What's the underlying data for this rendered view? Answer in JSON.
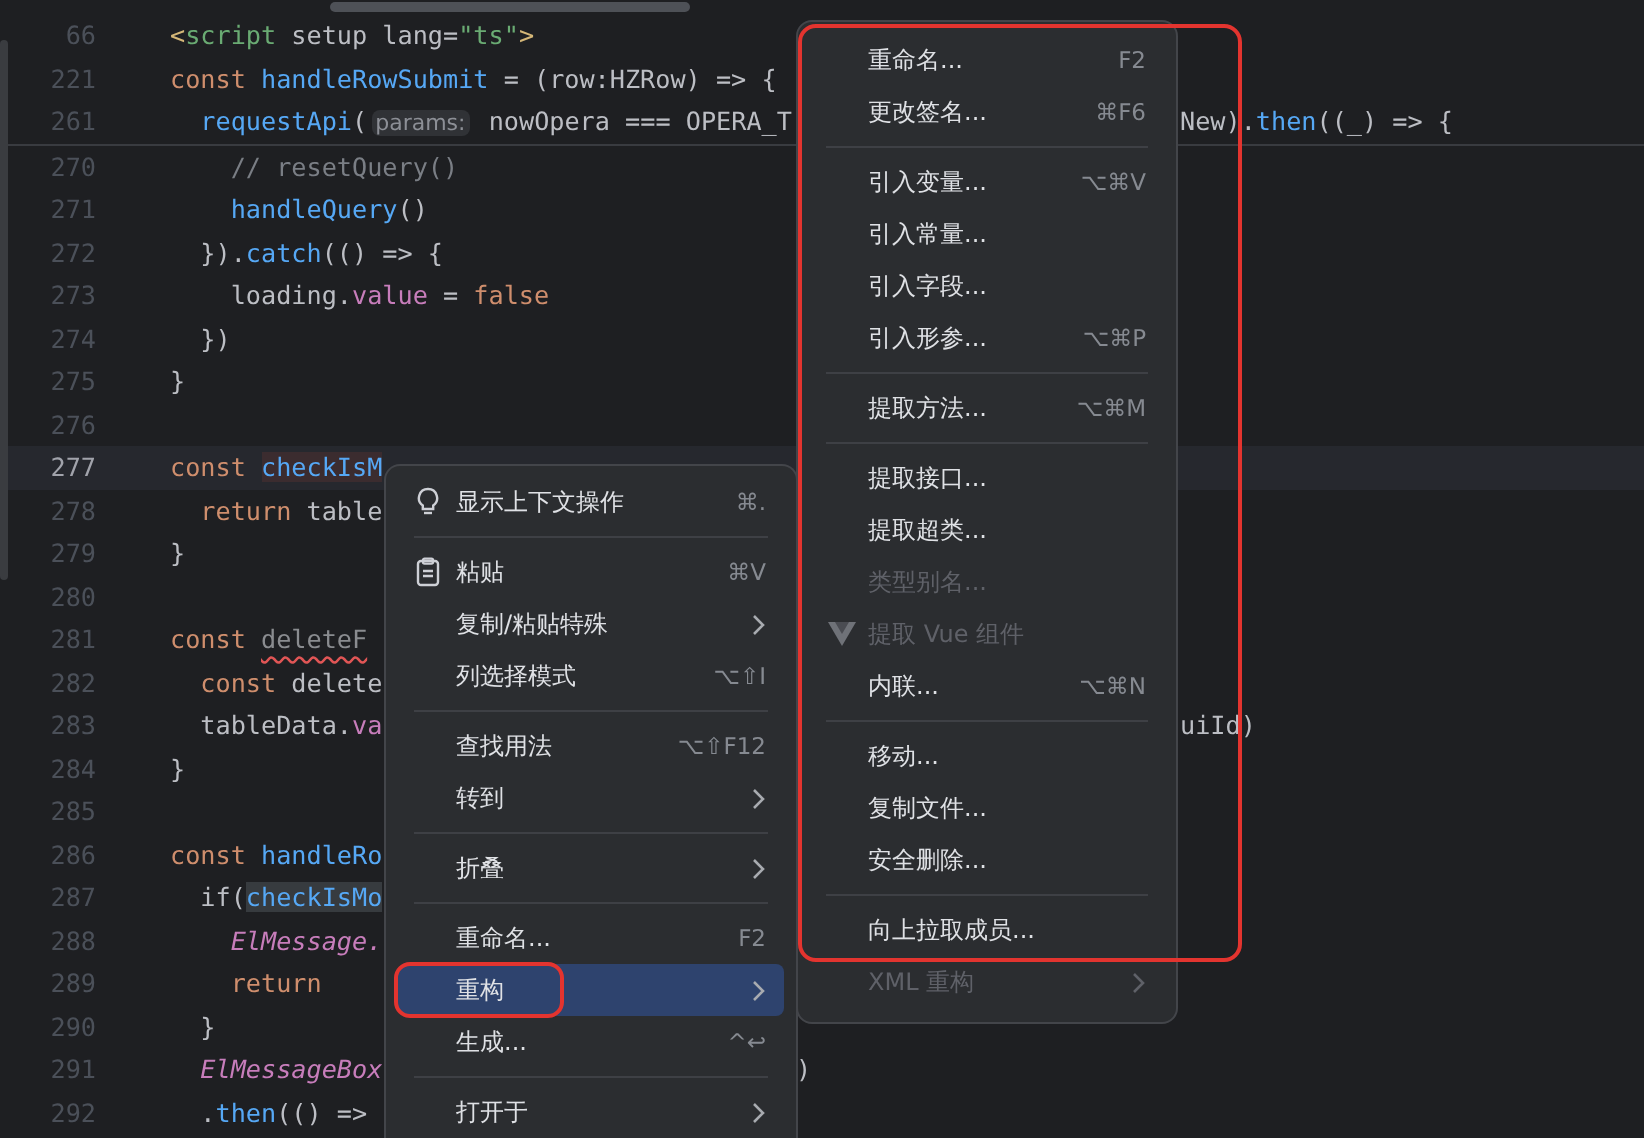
{
  "editor": {
    "sticky_lines": [
      {
        "number": "66",
        "current": false,
        "tokens": [
          {
            "kind": "tag",
            "text": "<"
          },
          {
            "kind": "tagname",
            "text": "script"
          },
          {
            "kind": "plain",
            "text": " setup lang="
          },
          {
            "kind": "string",
            "text": "\"ts\""
          },
          {
            "kind": "tag",
            "text": ">"
          }
        ]
      },
      {
        "number": "221",
        "current": false,
        "tokens": [
          {
            "kind": "keyword",
            "text": "const "
          },
          {
            "kind": "fn",
            "text": "handleRowSubmit"
          },
          {
            "kind": "plain",
            "text": " = (row:HZRow) => {"
          }
        ]
      },
      {
        "number": "261",
        "current": false,
        "tokens": [
          {
            "kind": "fn",
            "text": "  requestApi"
          },
          {
            "kind": "plain",
            "text": "("
          },
          {
            "kind": "inlay",
            "text": "params:"
          },
          {
            "kind": "plain",
            "text": " nowOpera === OPERA_T"
          }
        ],
        "far_tokens": [
          {
            "kind": "plain",
            "text": "New)."
          },
          {
            "kind": "fn",
            "text": "then"
          },
          {
            "kind": "plain",
            "text": "((_) => {"
          }
        ]
      }
    ],
    "lines": [
      {
        "number": "270",
        "current": false,
        "tokens": [
          {
            "kind": "comment",
            "text": "    // resetQuery()"
          }
        ]
      },
      {
        "number": "271",
        "current": false,
        "tokens": [
          {
            "kind": "fn",
            "text": "    handleQuery"
          },
          {
            "kind": "plain",
            "text": "()"
          }
        ]
      },
      {
        "number": "272",
        "current": false,
        "tokens": [
          {
            "kind": "plain",
            "text": "  })."
          },
          {
            "kind": "fn",
            "text": "catch"
          },
          {
            "kind": "plain",
            "text": "(() => {"
          }
        ]
      },
      {
        "number": "273",
        "current": false,
        "tokens": [
          {
            "kind": "plain",
            "text": "    loading."
          },
          {
            "kind": "prop",
            "text": "value"
          },
          {
            "kind": "plain",
            "text": " = "
          },
          {
            "kind": "keyword",
            "text": "false"
          }
        ]
      },
      {
        "number": "274",
        "current": false,
        "tokens": [
          {
            "kind": "plain",
            "text": "  })"
          }
        ]
      },
      {
        "number": "275",
        "current": false,
        "tokens": [
          {
            "kind": "plain",
            "text": "}"
          }
        ]
      },
      {
        "number": "276",
        "current": false
      },
      {
        "number": "277",
        "current": true,
        "tokens": [
          {
            "kind": "keyword",
            "text": "const "
          },
          {
            "kind": "fn_usage",
            "text": "checkIsM"
          }
        ]
      },
      {
        "number": "278",
        "current": false,
        "tokens": [
          {
            "kind": "keyword",
            "text": "  return "
          },
          {
            "kind": "plain",
            "text": "table"
          }
        ]
      },
      {
        "number": "279",
        "current": false,
        "tokens": [
          {
            "kind": "plain",
            "text": "}"
          }
        ]
      },
      {
        "number": "280",
        "current": false
      },
      {
        "number": "281",
        "current": false,
        "tokens": [
          {
            "kind": "keyword",
            "text": "const "
          },
          {
            "kind": "unused_error",
            "text": "deleteF"
          }
        ]
      },
      {
        "number": "282",
        "current": false,
        "tokens": [
          {
            "kind": "keyword",
            "text": "  const "
          },
          {
            "kind": "plain",
            "text": "delete"
          }
        ]
      },
      {
        "number": "283",
        "current": false,
        "tokens": [
          {
            "kind": "plain",
            "text": "  tableData."
          },
          {
            "kind": "prop",
            "text": "va"
          }
        ],
        "far_tokens": [
          {
            "kind": "plain",
            "text": "uiId)"
          }
        ]
      },
      {
        "number": "284",
        "current": false,
        "tokens": [
          {
            "kind": "plain",
            "text": "}"
          }
        ]
      },
      {
        "number": "285",
        "current": false
      },
      {
        "number": "286",
        "current": false,
        "tokens": [
          {
            "kind": "keyword",
            "text": "const "
          },
          {
            "kind": "fn",
            "text": "handleRo"
          }
        ]
      },
      {
        "number": "287",
        "current": false,
        "tokens": [
          {
            "kind": "plain",
            "text": "  if("
          },
          {
            "kind": "fn_highlight",
            "text": "checkIsMo"
          }
        ]
      },
      {
        "number": "288",
        "current": false,
        "tokens": [
          {
            "kind": "italic_prop",
            "text": "    ElMessage."
          }
        ]
      },
      {
        "number": "289",
        "current": false,
        "tokens": [
          {
            "kind": "keyword",
            "text": "    return"
          }
        ]
      },
      {
        "number": "290",
        "current": false,
        "tokens": [
          {
            "kind": "plain",
            "text": "  }"
          }
        ]
      },
      {
        "number": "291",
        "current": false,
        "tokens": [
          {
            "kind": "italic_prop",
            "text": "  ElMessageBox"
          }
        ],
        "mid_tokens": [
          {
            "kind": "plain",
            "text": ")"
          }
        ]
      },
      {
        "number": "292",
        "current": false,
        "tokens": [
          {
            "kind": "plain",
            "text": "  ."
          },
          {
            "kind": "fn",
            "text": "then"
          },
          {
            "kind": "plain",
            "text": "(() =>"
          }
        ]
      }
    ]
  },
  "context_menu": {
    "items": [
      {
        "kind": "item",
        "label": "显示上下文操作",
        "shortcut": "⌘.",
        "submenu": false,
        "disabled": false,
        "selected": false,
        "circled": false
      },
      {
        "kind": "separator"
      },
      {
        "kind": "item",
        "label": "粘贴",
        "shortcut": "⌘V",
        "submenu": false,
        "disabled": false,
        "selected": false,
        "circled": false
      },
      {
        "kind": "item",
        "label": "复制/粘贴特殊",
        "submenu": true,
        "disabled": false,
        "selected": false,
        "circled": false
      },
      {
        "kind": "item",
        "label": "列选择模式",
        "shortcut": "⌥⇧I",
        "submenu": false,
        "disabled": false,
        "selected": false,
        "circled": false
      },
      {
        "kind": "separator"
      },
      {
        "kind": "item",
        "label": "查找用法",
        "shortcut": "⌥⇧F12",
        "submenu": false,
        "disabled": false,
        "selected": false,
        "circled": false
      },
      {
        "kind": "item",
        "label": "转到",
        "submenu": true,
        "disabled": false,
        "selected": false,
        "circled": false
      },
      {
        "kind": "separator"
      },
      {
        "kind": "item",
        "label": "折叠",
        "submenu": true,
        "disabled": false,
        "selected": false,
        "circled": false
      },
      {
        "kind": "separator"
      },
      {
        "kind": "item",
        "label": "重命名...",
        "shortcut": "F2",
        "submenu": false,
        "disabled": false,
        "selected": false,
        "circled": false
      },
      {
        "kind": "item",
        "label": "重构",
        "submenu": true,
        "disabled": false,
        "selected": true,
        "circled": true
      },
      {
        "kind": "item",
        "label": "生成...",
        "shortcut": "^↩",
        "submenu": false,
        "disabled": false,
        "selected": false,
        "circled": false
      },
      {
        "kind": "separator"
      },
      {
        "kind": "item",
        "label": "打开于",
        "submenu": true,
        "disabled": false,
        "selected": false,
        "circled": false
      }
    ]
  },
  "refactor_submenu": {
    "circled": true,
    "items": [
      {
        "kind": "item",
        "label": "重命名...",
        "shortcut": "F2",
        "submenu": false,
        "disabled": false,
        "selected": false
      },
      {
        "kind": "item",
        "label": "更改签名...",
        "shortcut": "⌘F6",
        "submenu": false,
        "disabled": false,
        "selected": false
      },
      {
        "kind": "separator"
      },
      {
        "kind": "item",
        "label": "引入变量...",
        "shortcut": "⌥⌘V",
        "submenu": false,
        "disabled": false,
        "selected": false
      },
      {
        "kind": "item",
        "label": "引入常量...",
        "submenu": false,
        "disabled": false,
        "selected": false
      },
      {
        "kind": "item",
        "label": "引入字段...",
        "submenu": false,
        "disabled": false,
        "selected": false
      },
      {
        "kind": "item",
        "label": "引入形参...",
        "shortcut": "⌥⌘P",
        "submenu": false,
        "disabled": false,
        "selected": false
      },
      {
        "kind": "separator"
      },
      {
        "kind": "item",
        "label": "提取方法...",
        "shortcut": "⌥⌘M",
        "submenu": false,
        "disabled": false,
        "selected": false
      },
      {
        "kind": "separator"
      },
      {
        "kind": "item",
        "label": "提取接口...",
        "submenu": false,
        "disabled": false,
        "selected": false
      },
      {
        "kind": "item",
        "label": "提取超类...",
        "submenu": false,
        "disabled": false,
        "selected": false
      },
      {
        "kind": "item",
        "label": "类型别名...",
        "submenu": false,
        "disabled": true,
        "selected": false
      },
      {
        "kind": "item",
        "label": "提取 Vue 组件",
        "submenu": false,
        "disabled": true,
        "selected": false
      },
      {
        "kind": "item",
        "label": "内联...",
        "shortcut": "⌥⌘N",
        "submenu": false,
        "disabled": false,
        "selected": false
      },
      {
        "kind": "separator"
      },
      {
        "kind": "item",
        "label": "移动...",
        "submenu": false,
        "disabled": false,
        "selected": false
      },
      {
        "kind": "item",
        "label": "复制文件...",
        "submenu": false,
        "disabled": false,
        "selected": false
      },
      {
        "kind": "item",
        "label": "安全删除...",
        "submenu": false,
        "disabled": false,
        "selected": false
      },
      {
        "kind": "separator"
      },
      {
        "kind": "item",
        "label": "向上拉取成员...",
        "submenu": false,
        "disabled": false,
        "selected": false
      },
      {
        "kind": "item",
        "label": "XML 重构",
        "submenu": true,
        "disabled": true,
        "selected": false
      }
    ]
  }
}
